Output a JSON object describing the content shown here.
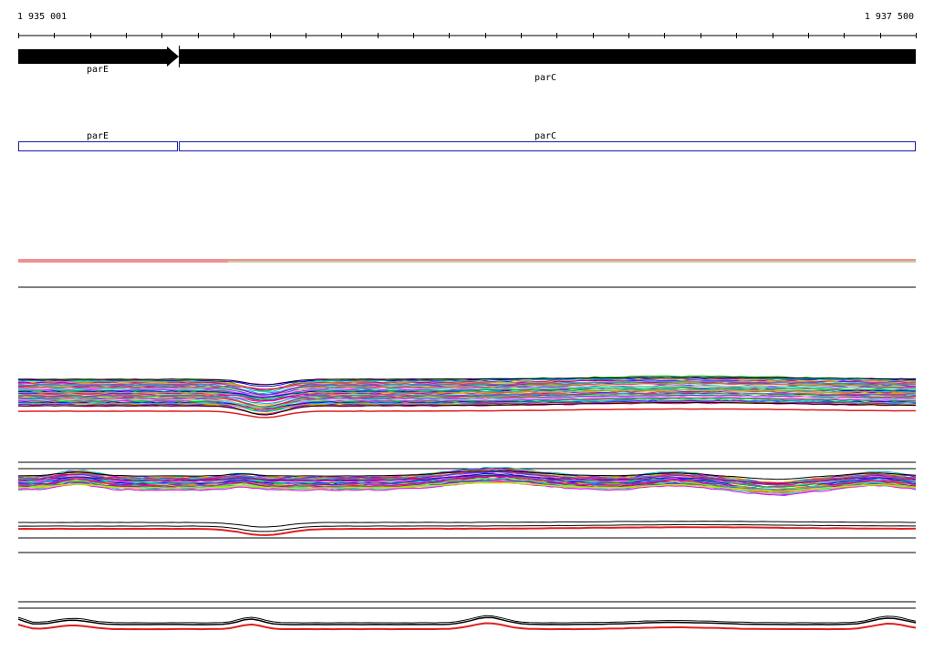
{
  "ruler": {
    "start_label": "1 935 001",
    "end_label": "1 937 500",
    "start": 1935001,
    "end": 1937500
  },
  "genes": [
    {
      "name": "parE",
      "start": 1935001,
      "end": 1935445
    },
    {
      "name": "parC",
      "start": 1935449,
      "end": 1937500
    }
  ],
  "colors": {
    "gene_arrow": "#000000",
    "cds_box": "#1a1aa8",
    "reference_line": "#e02020",
    "track_line": "#000000"
  }
}
